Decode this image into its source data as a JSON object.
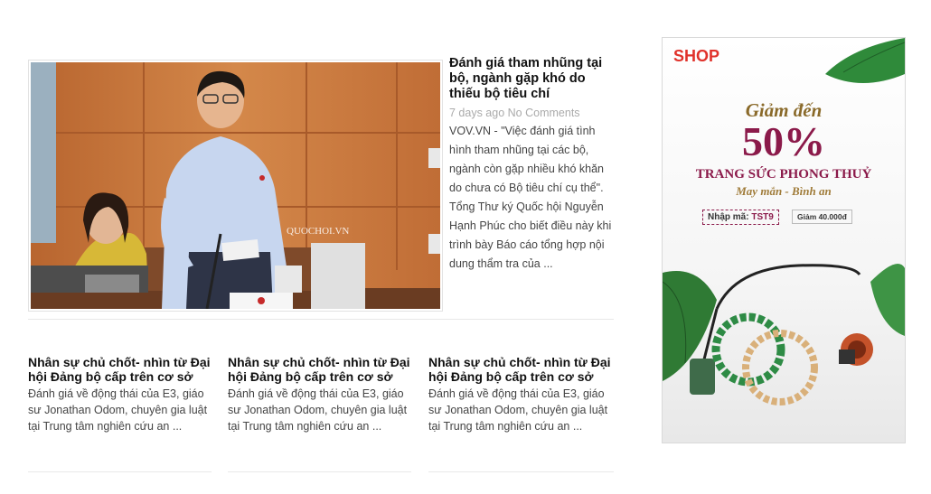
{
  "featured": {
    "title": "Đánh giá tham nhũng tại bộ, ngành gặp khó do thiếu bộ tiêu chí",
    "date": "7 days ago",
    "comments": "No Comments",
    "excerpt": "VOV.VN - \"Việc đánh giá tình hình tham nhũng tại các bộ, ngành còn gặp nhiều khó khăn do chưa có Bộ tiêu chí cụ thể\". Tổng Thư ký Quốc hội Nguyễn Hạnh Phúc cho biết điều này khi trình bày Báo cáo tổng hợp nội dung thẩm tra của ...",
    "image_watermark": "QUOCHOI.VN"
  },
  "cards": [
    {
      "title": "Nhân sự chủ chốt- nhìn từ Đại hội Đảng bộ cấp trên cơ sở",
      "excerpt": "Đánh giá về động thái của E3, giáo sư Jonathan Odom, chuyên gia luật tại Trung tâm nghiên cứu an ..."
    },
    {
      "title": "Nhân sự chủ chốt- nhìn từ Đại hội Đảng bộ cấp trên cơ sở",
      "excerpt": "Đánh giá về động thái của E3, giáo sư Jonathan Odom, chuyên gia luật tại Trung tâm nghiên cứu an ..."
    },
    {
      "title": "Nhân sự chủ chốt- nhìn từ Đại hội Đảng bộ cấp trên cơ sở",
      "excerpt": "Đánh giá về động thái của E3, giáo sư Jonathan Odom, chuyên gia luật tại Trung tâm nghiên cứu an ..."
    }
  ],
  "ad": {
    "logo": "SHOP",
    "headline": "Giảm đến",
    "percent": "50%",
    "line1": "TRANG SỨC PHONG THUỶ",
    "line2": "May mắn - Bình an",
    "code_label": "Nhập mã:",
    "code": "TST9",
    "discount": "Giảm 40.000đ"
  }
}
